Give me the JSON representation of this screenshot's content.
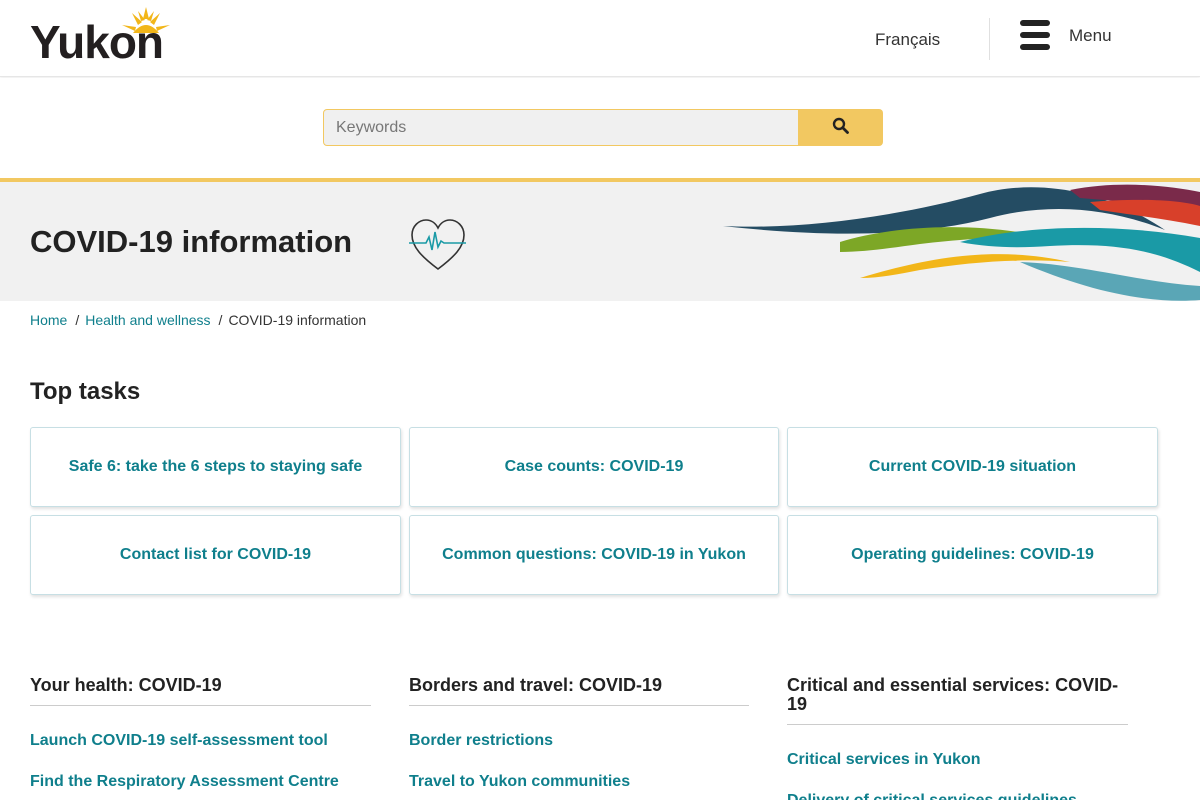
{
  "header": {
    "logo_text": "Yukon",
    "language_link": "Français",
    "menu_label": "Menu"
  },
  "search": {
    "placeholder": "Keywords"
  },
  "hero": {
    "title": "COVID-19 information"
  },
  "breadcrumb": {
    "items": [
      "Home",
      "Health and wellness"
    ],
    "current": "COVID-19 information"
  },
  "top_tasks": {
    "title": "Top tasks",
    "items": [
      "Safe 6: take the 6 steps to staying safe",
      "Case counts: COVID-19",
      "Current COVID-19 situation",
      "Contact list for COVID-19",
      "Common questions: COVID-19 in Yukon",
      "Operating guidelines: COVID-19"
    ]
  },
  "columns": [
    {
      "heading": "Your health: COVID-19",
      "links": [
        "Launch COVID-19 self-assessment tool",
        "Find the Respiratory Assessment Centre"
      ]
    },
    {
      "heading": "Borders and travel: COVID-19",
      "links": [
        "Border restrictions",
        "Travel to Yukon communities"
      ]
    },
    {
      "heading": "Critical and essential services: COVID-19",
      "links": [
        "Critical services in Yukon",
        "Delivery of critical services guidelines"
      ]
    }
  ],
  "colors": {
    "accent_yellow": "#f2c861",
    "link_teal": "#0f7f8c"
  }
}
